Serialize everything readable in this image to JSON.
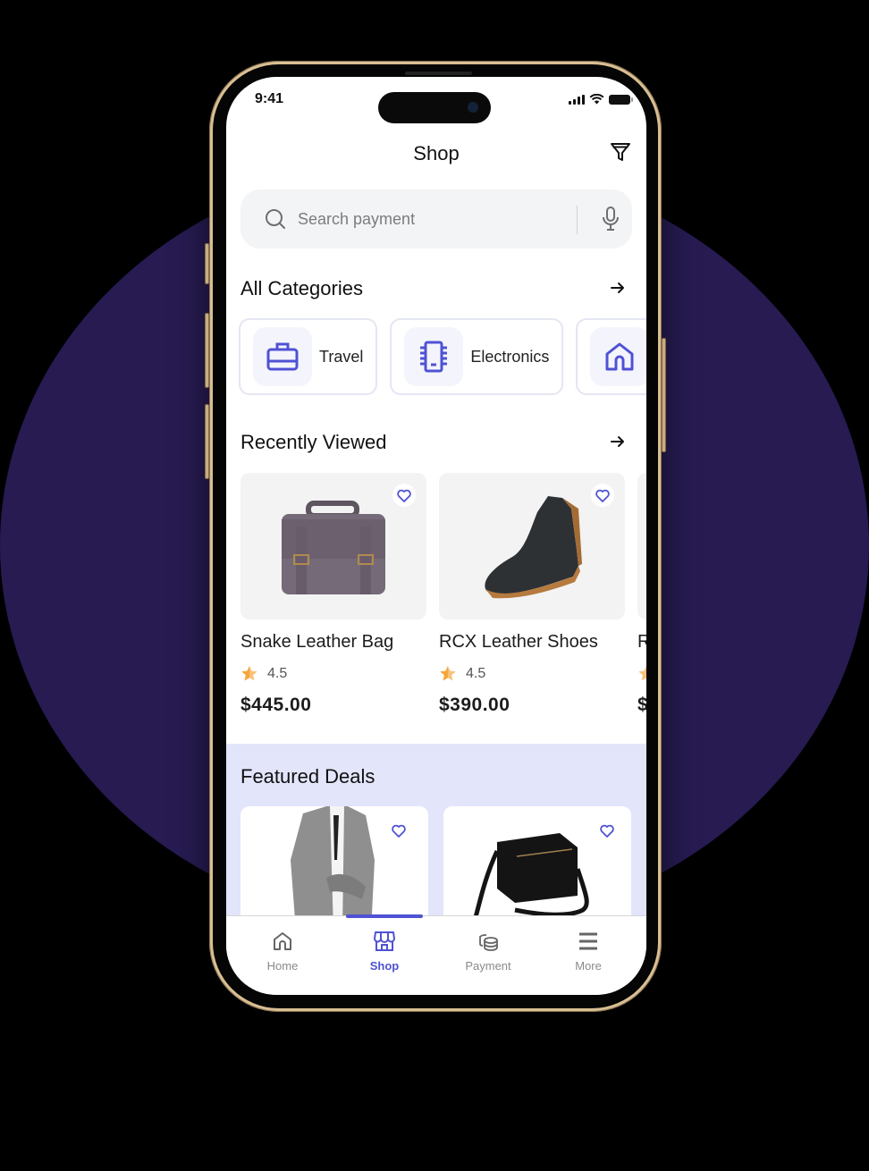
{
  "status_bar": {
    "time": "9:41"
  },
  "header": {
    "title": "Shop",
    "filter_icon": "filter-icon"
  },
  "search": {
    "placeholder": "Search payment",
    "value": "",
    "search_icon": "search-icon",
    "mic_icon": "microphone-icon"
  },
  "categories": {
    "title": "All Categories",
    "items": [
      {
        "label": "Travel",
        "icon": "briefcase-icon"
      },
      {
        "label": "Electronics",
        "icon": "chip-icon"
      },
      {
        "label": "",
        "icon": "home-icon"
      }
    ]
  },
  "recently_viewed": {
    "title": "Recently Viewed",
    "items": [
      {
        "name": "Snake Leather Bag",
        "rating": "4.5",
        "price": "$445.00",
        "image": "leather-satchel-bag"
      },
      {
        "name": "RCX Leather Shoes",
        "rating": "4.5",
        "price": "$390.00",
        "image": "dark-suede-boot"
      },
      {
        "name": "R",
        "rating": "",
        "price": "$",
        "image": ""
      }
    ]
  },
  "featured_deals": {
    "title": "Featured Deals",
    "items": [
      {
        "image": "plaid-blazer-woman"
      },
      {
        "image": "black-crossbody-bag"
      }
    ]
  },
  "tabbar": {
    "items": [
      {
        "label": "Home",
        "icon": "home-icon",
        "active": false
      },
      {
        "label": "Shop",
        "icon": "store-icon",
        "active": true
      },
      {
        "label": "Payment",
        "icon": "coins-icon",
        "active": false
      },
      {
        "label": "More",
        "icon": "menu-icon",
        "active": false
      }
    ]
  },
  "colors": {
    "accent": "#4f52d3",
    "featured_bg": "#e3e5fb",
    "backdrop_circle": "#271b52",
    "star": "#f5a53a"
  }
}
